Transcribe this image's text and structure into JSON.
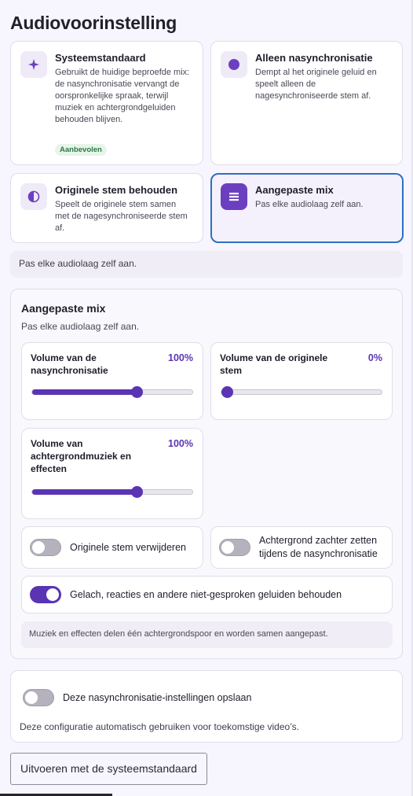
{
  "page": {
    "title": "Audiovoorinstelling"
  },
  "options": [
    {
      "title": "Systeemstandaard",
      "desc": "Gebruikt de huidige beproefde mix: de nasynchronisatie vervangt de oorspronkelijke spraak, terwijl muziek en achtergrondgeluiden behouden blijven.",
      "badge": "Aanbevolen",
      "icon": "sparkle-icon"
    },
    {
      "title": "Alleen nasynchronisatie",
      "desc": "Dempt al het originele geluid en speelt alleen de nagesynchroniseerde stem af.",
      "icon": "circle-icon"
    },
    {
      "title": "Originele stem behouden",
      "desc": "Speelt de originele stem samen met de nagesynchroniseerde stem af.",
      "icon": "half-circle-icon"
    },
    {
      "title": "Aangepaste mix",
      "desc": "Pas elke audiolaag zelf aan.",
      "icon": "layers-icon",
      "selected": true
    }
  ],
  "selected_info": "Pas elke audiolaag zelf aan.",
  "custom_mix": {
    "title": "Aangepaste mix",
    "subtitle": "Pas elke audiolaag zelf aan.",
    "sliders": [
      {
        "label": "Volume van de nasynchronisatie",
        "value_text": "100%",
        "value": 1.0
      },
      {
        "label": "Volume van de originele stem",
        "value_text": "0%",
        "value": 0.0
      },
      {
        "label": "Volume van achtergrondmuziek en effecten",
        "value_text": "100%",
        "value": 1.0
      }
    ],
    "toggles": [
      {
        "label": "Originele stem verwijderen",
        "on": false
      },
      {
        "label": "Achtergrond zachter zetten tijdens de nasynchronisatie",
        "on": false
      },
      {
        "label": "Gelach, reacties en andere niet-gesproken geluiden behouden",
        "on": true
      }
    ],
    "note": "Muziek en effecten delen één achtergrondspoor en worden samen aangepast."
  },
  "save": {
    "label": "Deze nasynchronisatie-instellingen opslaan",
    "on": false,
    "description": "Deze configuratie automatisch gebruiken voor toekomstige video’s."
  },
  "run_button": "Uitvoeren met de systeemstandaard",
  "colors": {
    "accent": "#5b34b3",
    "selected_border": "#2f6fc4",
    "background": "#f7f5fd"
  }
}
